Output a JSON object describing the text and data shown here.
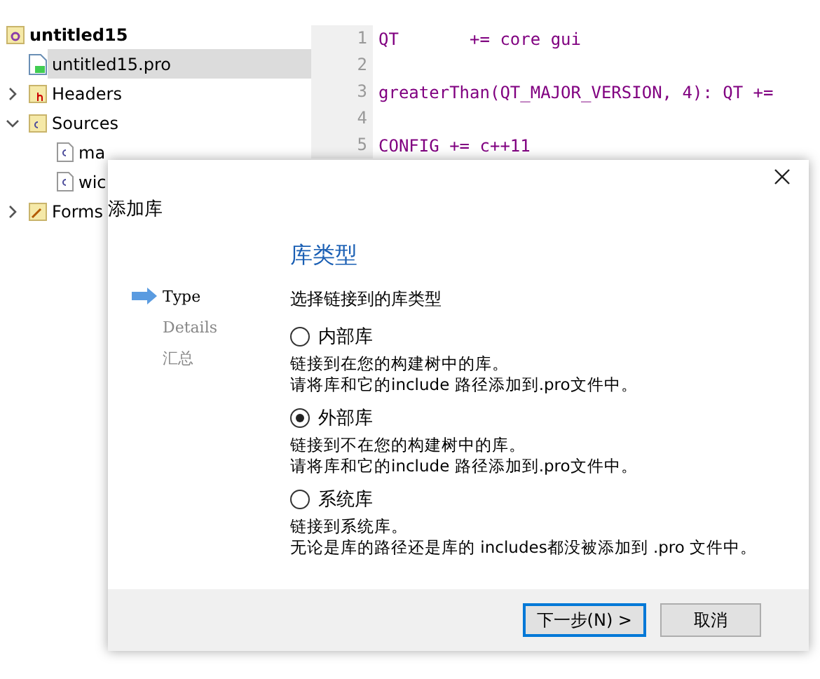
{
  "project_tree": [
    {
      "label": "untitled15",
      "kind": "project",
      "selected": false,
      "children": [
        {
          "label": "untitled15.pro",
          "kind": "pro",
          "selected": true
        },
        {
          "label": "Headers",
          "kind": "folder-h",
          "selected": false,
          "expanded": false
        },
        {
          "label": "Sources",
          "kind": "folder-cpp",
          "selected": false,
          "expanded": true,
          "children": [
            {
              "label": "ma",
              "kind": "cpp",
              "selected": false
            },
            {
              "label": "wic",
              "kind": "cpp",
              "selected": false
            }
          ]
        },
        {
          "label": "Forms",
          "kind": "folder-forms",
          "selected": false,
          "expanded": false
        }
      ]
    }
  ],
  "editor": {
    "lines": [
      {
        "number": "1",
        "text": "QT       += core gui"
      },
      {
        "number": "2"
      },
      {
        "number": "3",
        "text": "greaterThan(QT_MAJOR_VERSION, 4): QT +="
      },
      {
        "number": "4"
      },
      {
        "number": "5",
        "text": "CONFIG += c++11"
      }
    ]
  },
  "dialog": {
    "title": "添加库",
    "steps": [
      {
        "label": "Type",
        "selected": true
      },
      {
        "label": "Details",
        "selected": false
      },
      {
        "label": "汇总",
        "selected": false
      }
    ],
    "heading": "库类型",
    "prompt": "选择链接到的库类型",
    "options": [
      {
        "label": "内部库",
        "selected": false,
        "description": [
          "链接到在您的构建树中的库。",
          "请将库和它的include 路径添加到.pro文件中。"
        ]
      },
      {
        "label": "外部库",
        "selected": true,
        "description": [
          "链接到不在您的构建树中的库。",
          "请将库和它的include 路径添加到.pro文件中。"
        ]
      },
      {
        "label": "系统库",
        "selected": false,
        "description": [
          "链接到系统库。",
          "无论是库的路径还是库的 includes都没被添加到 .pro 文件中。"
        ]
      }
    ],
    "buttons": [
      {
        "label": "下一步(N) >",
        "kind": "default"
      },
      {
        "label": "取消",
        "kind": "normal"
      }
    ]
  }
}
